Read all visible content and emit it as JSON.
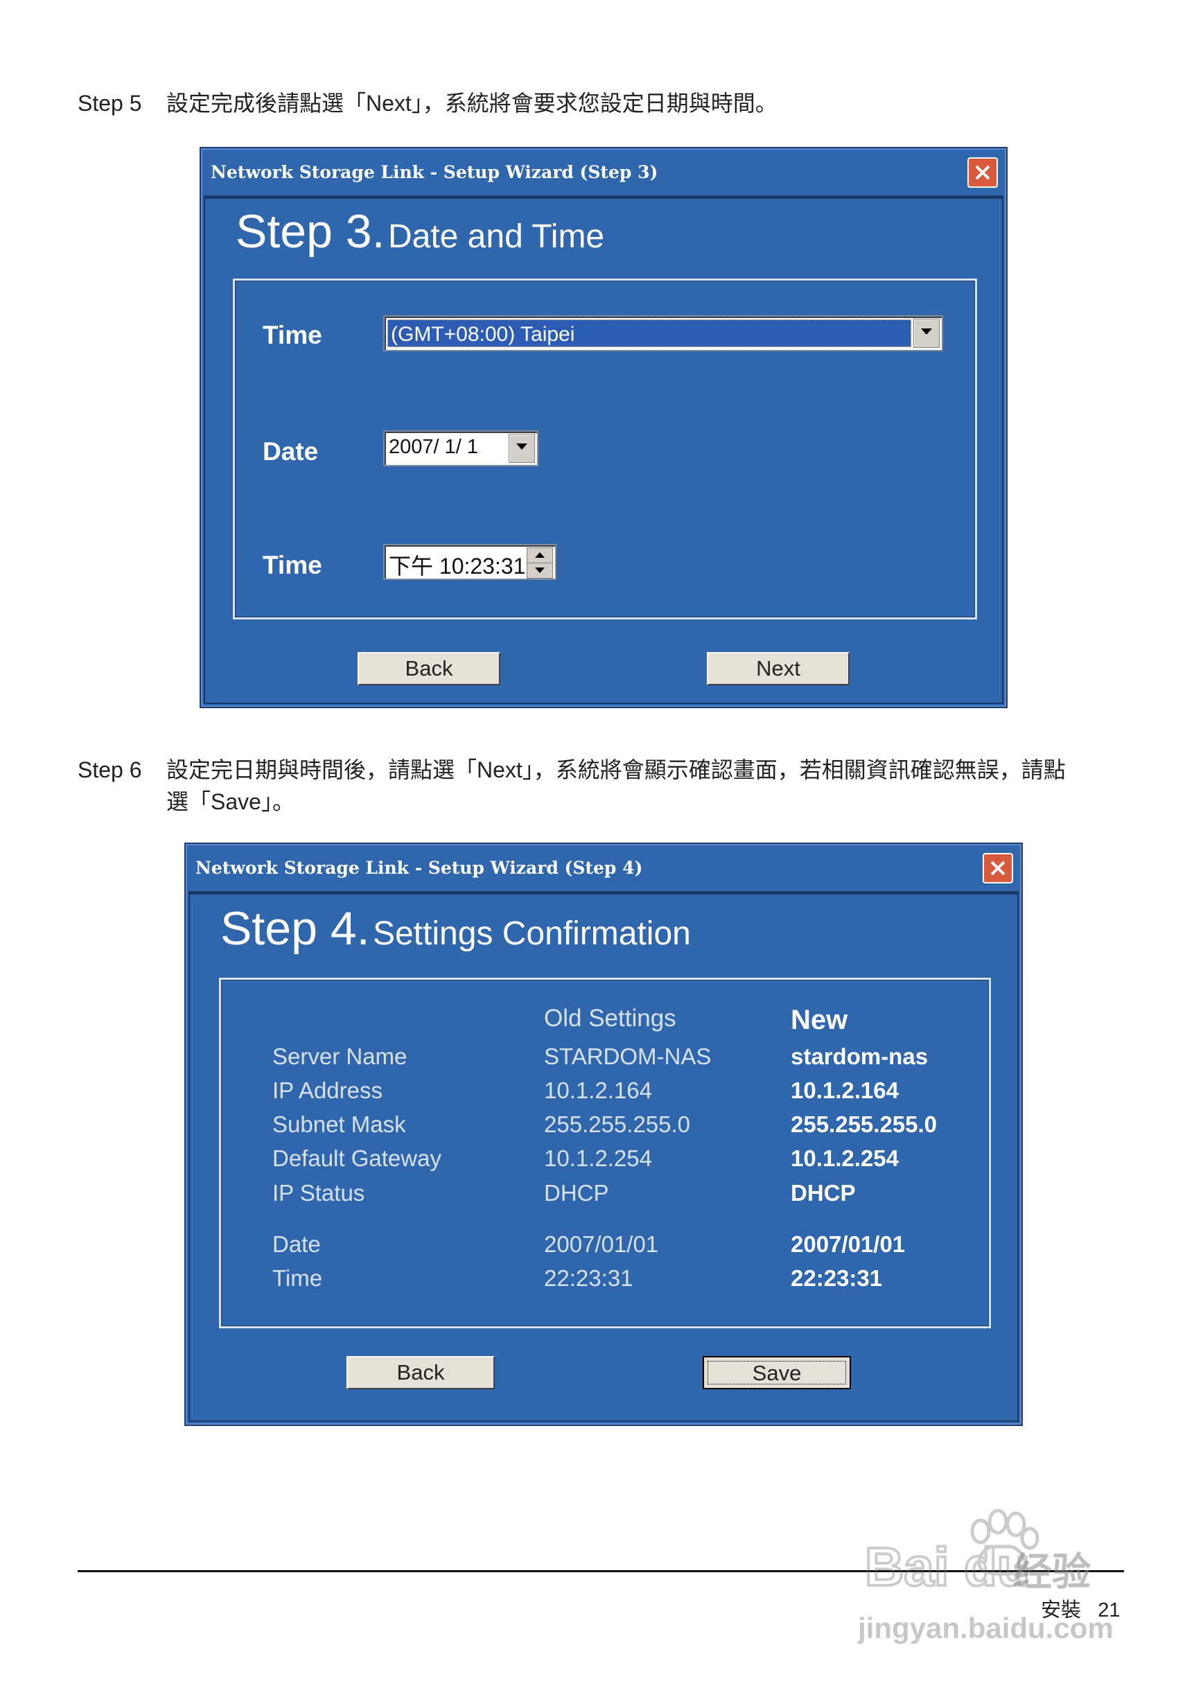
{
  "step5": {
    "num": "Step 5",
    "text": "設定完成後請點選「Next」，系統將會要求您設定日期與時間。"
  },
  "step6": {
    "num": "Step 6",
    "line1": "設定完日期與時間後，請點選「Next」，系統將會顯示確認畫面，若相關資訊確認無誤，請點",
    "line2": "選「Save」。"
  },
  "dialog3": {
    "title": "Network Storage Link - Setup Wizard (Step 3)",
    "heading_step": "Step 3.",
    "heading_text": "Date and Time",
    "timezone_label": "Time",
    "timezone_value": "(GMT+08:00) Taipei",
    "date_label": "Date",
    "date_value": "2007/ 1/ 1",
    "time_label": "Time",
    "time_value": "下午 10:23:31",
    "back_label": "Back",
    "next_label": "Next"
  },
  "dialog4": {
    "title": "Network Storage Link - Setup Wizard (Step 4)",
    "heading_step": "Step 4.",
    "heading_text": "Settings Confirmation",
    "col_old": "Old Settings",
    "col_new": "New",
    "rows": [
      {
        "label": "Server Name",
        "old": "STARDOM-NAS",
        "new": "stardom-nas"
      },
      {
        "label": "IP Address",
        "old": "10.1.2.164",
        "new": "10.1.2.164"
      },
      {
        "label": "Subnet Mask",
        "old": "255.255.255.0",
        "new": "255.255.255.0"
      },
      {
        "label": "Default Gateway",
        "old": "10.1.2.254",
        "new": "10.1.2.254"
      },
      {
        "label": "IP Status",
        "old": "DHCP",
        "new": "DHCP"
      },
      {
        "label": "Date",
        "old": "2007/01/01",
        "new": "2007/01/01"
      },
      {
        "label": "Time",
        "old": "22:23:31",
        "new": "22:23:31"
      }
    ],
    "back_label": "Back",
    "save_label": "Save"
  },
  "footer": {
    "section": "安裝",
    "page": "21"
  },
  "watermark": {
    "brand": "Bai du",
    "cn": "经验",
    "url": "jingyan.baidu.com"
  },
  "colors": {
    "window_blue": "#2f66ac",
    "close_red": "#d9593d",
    "selection_blue": "#2d5cb5"
  }
}
